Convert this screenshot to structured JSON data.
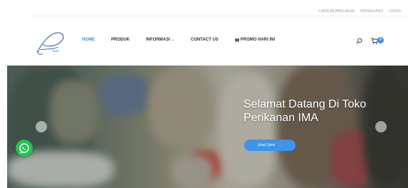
{
  "topbar": {
    "links": [
      "CARA BERBELANJA",
      "KERANJANG",
      "LOGIN"
    ]
  },
  "header": {
    "logo_icon": "fishing-lure-logo",
    "nav": [
      {
        "label": "HOME",
        "active": true
      },
      {
        "label": "PRODUK",
        "active": false
      },
      {
        "label": "INFORMASI",
        "active": false,
        "dropdown": true
      },
      {
        "label": "CONTACT US",
        "active": false
      },
      {
        "label": "PROMO HARI INI",
        "active": false,
        "icon": "gift-icon"
      }
    ],
    "cart_count": "0"
  },
  "hero": {
    "title_line1": "Selamat Datang Di Toko",
    "title_line2": "Perikanan IMA",
    "button_label": "Lihat Disini",
    "button_arrow": "→"
  },
  "colors": {
    "accent": "#3a8fe0",
    "whatsapp": "#25c253"
  }
}
